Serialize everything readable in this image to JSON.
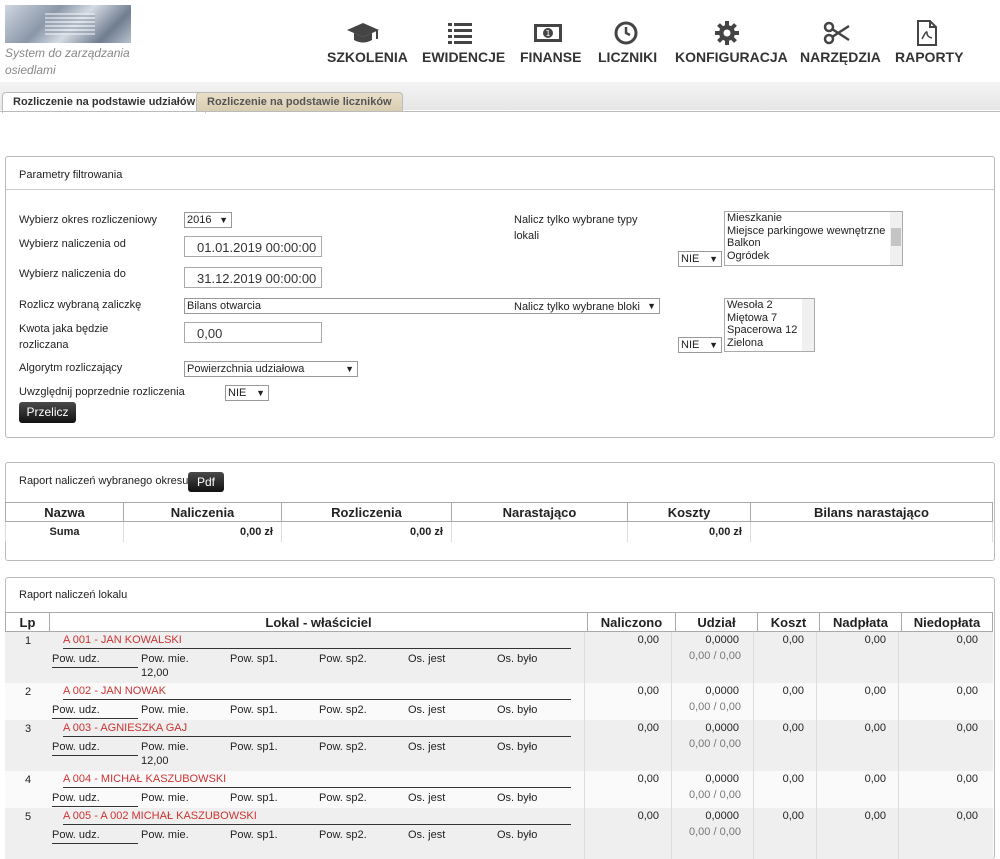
{
  "logo": {
    "text": "System do zarządzania osiedlami"
  },
  "nav": [
    {
      "label": "SZKOLENIA",
      "icon": "graduation-cap-icon"
    },
    {
      "label": "EWIDENCJE",
      "icon": "list-icon"
    },
    {
      "label": "FINANSE",
      "icon": "money-icon"
    },
    {
      "label": "LICZNIKI",
      "icon": "clock-icon"
    },
    {
      "label": "KONFIGURACJA",
      "icon": "gear-icon"
    },
    {
      "label": "NARZĘDZIA",
      "icon": "scissors-icon"
    },
    {
      "label": "RAPORTY",
      "icon": "pdf-file-icon"
    }
  ],
  "tabs": [
    {
      "label": "Rozliczenie na podstawie udziałów"
    },
    {
      "label": "Rozliczenie na podstawie liczników"
    }
  ],
  "filters": {
    "title": "Parametry filtrowania",
    "period_label": "Wybierz okres rozliczeniowy",
    "period_value": "2016",
    "from_label": "Wybierz naliczenia od",
    "from_value": "01.01.2019 00:00:00",
    "to_label": "Wybierz naliczenia do",
    "to_value": "31.12.2019 00:00:00",
    "advance_label": "Rozlicz wybraną zaliczkę",
    "advance_value": "Bilans otwarcia",
    "amount_label_1": "Kwota jaka będzie",
    "amount_label_2": "rozliczana",
    "amount_value": "0,00",
    "algorithm_label": "Algorytm rozliczający",
    "algorithm_value": "Powierzchnia udziałowa",
    "previous_label": "Uwzględnij poprzednie rozliczenia",
    "previous_value": "NIE",
    "calc_button": "Przelicz",
    "types_label_1": "Nalicz tylko wybrane typy",
    "types_label_2": "lokali",
    "types_toggle": "NIE",
    "types_options": [
      "Mieszkanie",
      "Miejsce parkingowe wewnętrzne",
      "Balkon",
      "Ogródek"
    ],
    "blocks_label": "Nalicz tylko wybrane bloki",
    "blocks_toggle": "NIE",
    "blocks_options": [
      "Wesoła 2",
      "Miętowa 7",
      "Spacerowa 12",
      "Zielona"
    ]
  },
  "period_report": {
    "title": "Raport naliczeń wybranego okresu",
    "pdf_button": "Pdf",
    "headers": [
      "Nazwa",
      "Naliczenia",
      "Rozliczenia",
      "Narastająco",
      "Koszty",
      "Bilans narastająco"
    ],
    "sum_row": {
      "name": "Suma",
      "naliczenia": "0,00 zł",
      "rozliczenia": "0,00 zł",
      "narastajaco": "",
      "koszty": "0,00 zł",
      "bilans": ""
    }
  },
  "unit_report": {
    "title": "Raport naliczeń lokalu",
    "headers": [
      "Lp",
      "Lokal - właściciel",
      "Naliczono",
      "Udział",
      "Koszt",
      "Nadpłata",
      "Niedopłata"
    ],
    "sub_headers": [
      "Pow. udz.",
      "Pow. mie.",
      "Pow. sp1.",
      "Pow. sp2.",
      "Os. jest",
      "Os. było"
    ],
    "rows": [
      {
        "lp": "1",
        "unit": "A 001",
        "sep": " - ",
        "owner": "JAN KOWALSKI",
        "pow_mie": "12,00",
        "naliczono": "0,00",
        "udzial": "0,0000",
        "udzial_sub": "0,00 / 0,00",
        "koszt": "0,00",
        "nadplata": "0,00",
        "niedoplata": "0,00"
      },
      {
        "lp": "2",
        "unit": "A 002",
        "sep": " - ",
        "owner": "JAN NOWAK",
        "pow_mie": "",
        "naliczono": "0,00",
        "udzial": "0,0000",
        "udzial_sub": "0,00 / 0,00",
        "koszt": "0,00",
        "nadplata": "0,00",
        "niedoplata": "0,00"
      },
      {
        "lp": "3",
        "unit": "A 003",
        "sep": " - ",
        "owner": "AGNIESZKA GAJ",
        "pow_mie": "12,00",
        "naliczono": "0,00",
        "udzial": "0,0000",
        "udzial_sub": "0,00 / 0,00",
        "koszt": "0,00",
        "nadplata": "0,00",
        "niedoplata": "0,00"
      },
      {
        "lp": "4",
        "unit": "A 004",
        "sep": " - ",
        "owner": "MICHAŁ KASZUBOWSKI",
        "pow_mie": "",
        "naliczono": "0,00",
        "udzial": "0,0000",
        "udzial_sub": "0,00 / 0,00",
        "koszt": "0,00",
        "nadplata": "0,00",
        "niedoplata": "0,00"
      },
      {
        "lp": "5",
        "unit": "A 005",
        "sep": " - ",
        "owner": "A 002 MICHAŁ KASZUBOWSKI",
        "pow_mie": "",
        "naliczono": "0,00",
        "udzial": "0,0000",
        "udzial_sub": "0,00 / 0,00",
        "koszt": "0,00",
        "nadplata": "0,00",
        "niedoplata": "0,00"
      }
    ]
  },
  "colors": {
    "link": "#cc3333",
    "tab_inactive": "#ddd0b4",
    "button_dark": "#222222"
  }
}
